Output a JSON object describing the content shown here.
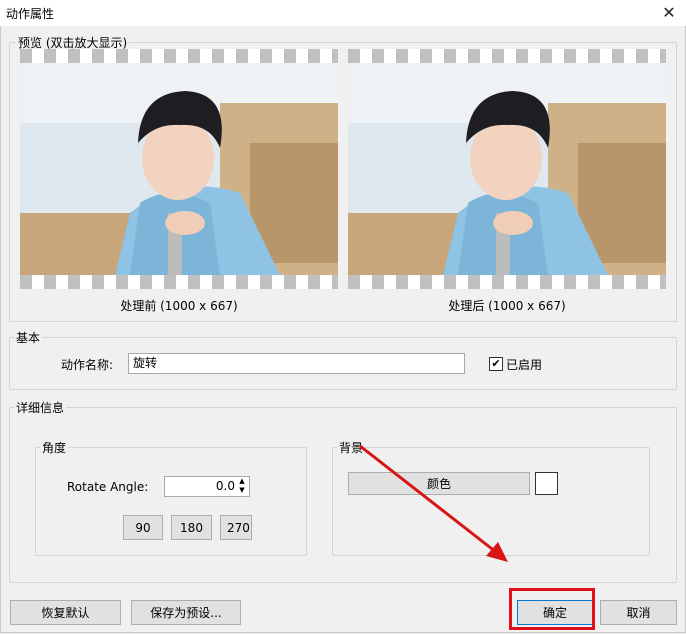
{
  "window": {
    "title": "动作属性",
    "close_glyph": "✕"
  },
  "preview": {
    "legend": "预览 (双击放大显示)",
    "before_caption": "处理前 (1000 x 667)",
    "after_caption": "处理后 (1000 x 667)"
  },
  "basic": {
    "legend": "基本",
    "name_label": "动作名称:",
    "name_value": "旋转",
    "enabled_label": "已启用",
    "enabled_check": "✔"
  },
  "details": {
    "legend": "详细信息",
    "angle": {
      "legend": "角度",
      "rotate_label": "Rotate Angle:",
      "rotate_value": "0.0",
      "presets": [
        "90",
        "180",
        "270"
      ]
    },
    "background": {
      "legend": "背景",
      "color_button": "颜色",
      "swatch_color": "#ffffff"
    }
  },
  "footer": {
    "reset": "恢复默认",
    "save_preset": "保存为预设...",
    "ok": "确定",
    "cancel": "取消"
  },
  "colors": {
    "highlight": "#e0101a",
    "arrow": "#d81414"
  }
}
